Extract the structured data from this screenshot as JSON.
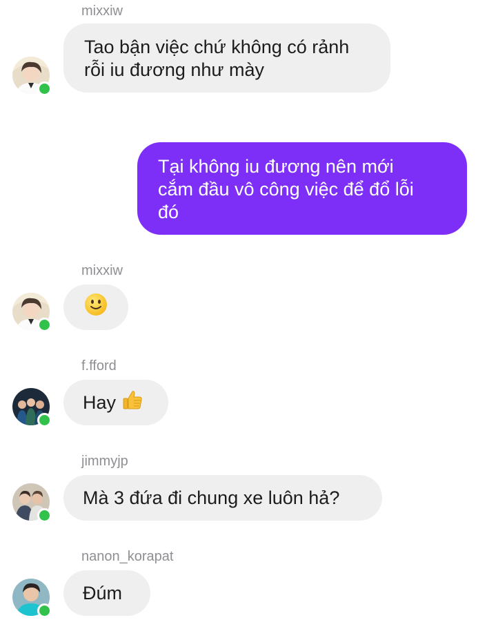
{
  "messages": [
    {
      "type": "incoming",
      "sender": "mixxiw",
      "text_lines": [
        "Tao bận việc chứ không có rảnh",
        "rỗi iu đương như mày"
      ]
    },
    {
      "type": "outgoing",
      "text_lines": [
        "Tại không iu đương nên mới",
        "cắm đầu vô công việc để đổ lỗi",
        "đó"
      ]
    },
    {
      "type": "incoming",
      "sender": "mixxiw",
      "emoji": "slightly-smiling-face-icon"
    },
    {
      "type": "incoming",
      "sender": "f.fford",
      "text": "Hay",
      "emoji": "thumbs-up-icon"
    },
    {
      "type": "incoming",
      "sender": "jimmyjp",
      "text": "Mà 3 đứa đi chung xe luôn hả?"
    },
    {
      "type": "incoming",
      "sender": "nanon_korapat",
      "text": "Đúm"
    }
  ],
  "colors": {
    "outgoing_bubble": "#7d2ff7",
    "incoming_bubble": "#efefef",
    "online_indicator": "#31c24b",
    "sender_name": "#8e8e93"
  }
}
